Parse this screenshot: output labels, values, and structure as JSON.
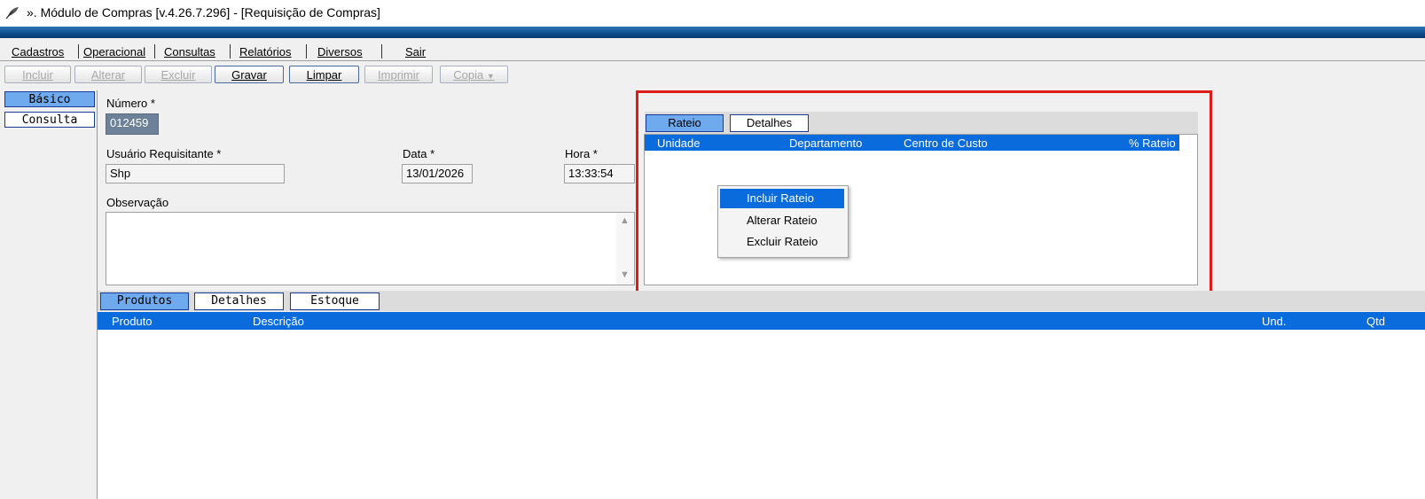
{
  "window": {
    "title": "». Módulo de Compras [v.4.26.7.296] - [Requisição de Compras]"
  },
  "menu": [
    "Cadastros",
    "Operacional",
    "Consultas",
    "Relatórios",
    "Diversos",
    "Sair"
  ],
  "toolbar": {
    "incluir": "Incluir",
    "alterar": "Alterar",
    "excluir": "Excluir",
    "gravar": "Gravar",
    "limpar": "Limpar",
    "imprimir": "Imprimir",
    "copia": "Copia"
  },
  "side_tabs": {
    "basico": "Básico",
    "consulta": "Consulta"
  },
  "form": {
    "numero_label": "Número *",
    "numero_value": "012459",
    "usuario_label": "Usuário Requisitante *",
    "usuario_value": "Shp",
    "data_label": "Data *",
    "data_value": "13/01/2026",
    "hora_label": "Hora *",
    "hora_value": "13:33:54",
    "observacao_label": "Observação",
    "observacao_value": ""
  },
  "rateio": {
    "tabs": [
      "Rateio",
      "Detalhes"
    ],
    "columns": [
      "Unidade",
      "Departamento",
      "Centro de Custo",
      "% Rateio"
    ],
    "context_menu": [
      "Incluir Rateio",
      "Alterar Rateio",
      "Excluir Rateio"
    ]
  },
  "produtos": {
    "tabs": [
      "Produtos",
      "Detalhes",
      "Estoque"
    ],
    "columns": [
      "Produto",
      "Descrição",
      "Und.",
      "Qtd"
    ]
  },
  "colors": {
    "accent": "#0a6bdc",
    "tab_selected": "#6fa9ee",
    "highlight_box": "#e01b1b"
  }
}
